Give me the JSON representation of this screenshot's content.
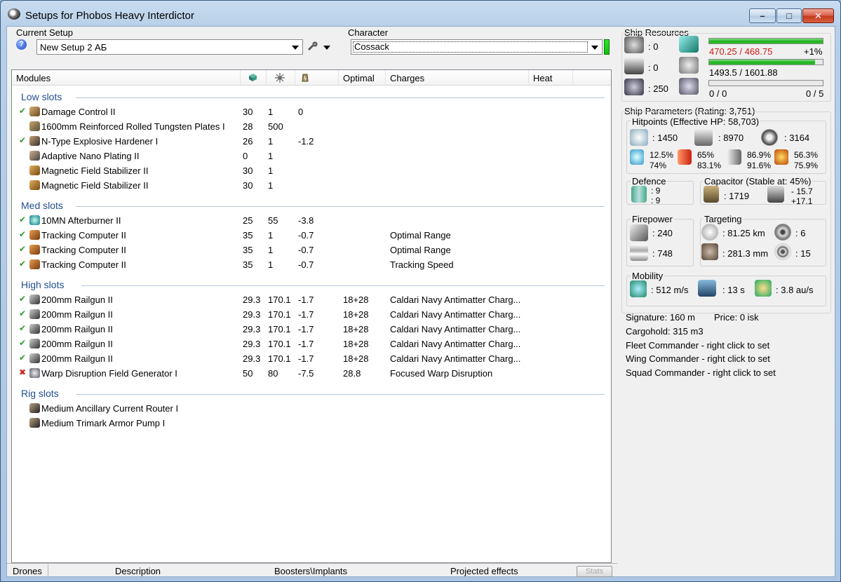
{
  "window": {
    "title": "Setups for Phobos Heavy Interdictor"
  },
  "current_setup": {
    "label": "Current Setup",
    "value": "New Setup 2 АБ"
  },
  "character": {
    "label": "Character",
    "value": "Cossack"
  },
  "modules": {
    "headers": {
      "modules": "Modules",
      "optimal": "Optimal",
      "charges": "Charges",
      "heat": "Heat"
    },
    "sections": [
      {
        "title": "Low slots",
        "rows": [
          {
            "state": "on",
            "icon": "damage-control-icon",
            "name": "Damage Control II",
            "c1": "30",
            "c2": "1",
            "c3": "0",
            "optimal": "",
            "charges": ""
          },
          {
            "state": "none",
            "icon": "armor-plate-icon",
            "name": "1600mm Reinforced Rolled Tungsten Plates I",
            "c1": "28",
            "c2": "500",
            "c3": "",
            "optimal": "",
            "charges": ""
          },
          {
            "state": "on",
            "icon": "armor-hardener-icon",
            "name": "N-Type Explosive Hardener I",
            "c1": "26",
            "c2": "1",
            "c3": "-1.2",
            "optimal": "",
            "charges": ""
          },
          {
            "state": "none",
            "icon": "nano-plating-icon",
            "name": "Adaptive Nano Plating II",
            "c1": "0",
            "c2": "1",
            "c3": "",
            "optimal": "",
            "charges": ""
          },
          {
            "state": "none",
            "icon": "mag-stab-icon",
            "name": "Magnetic Field Stabilizer II",
            "c1": "30",
            "c2": "1",
            "c3": "",
            "optimal": "",
            "charges": ""
          },
          {
            "state": "none",
            "icon": "mag-stab-icon",
            "name": "Magnetic Field Stabilizer II",
            "c1": "30",
            "c2": "1",
            "c3": "",
            "optimal": "",
            "charges": ""
          }
        ]
      },
      {
        "title": "Med slots",
        "rows": [
          {
            "state": "on",
            "icon": "afterburner-icon",
            "name": "10MN Afterburner II",
            "c1": "25",
            "c2": "55",
            "c3": "-3.8",
            "optimal": "",
            "charges": ""
          },
          {
            "state": "on",
            "icon": "tracking-computer-icon",
            "name": "Tracking Computer II",
            "c1": "35",
            "c2": "1",
            "c3": "-0.7",
            "optimal": "",
            "charges": "Optimal Range"
          },
          {
            "state": "on",
            "icon": "tracking-computer-icon",
            "name": "Tracking Computer II",
            "c1": "35",
            "c2": "1",
            "c3": "-0.7",
            "optimal": "",
            "charges": "Optimal Range"
          },
          {
            "state": "on",
            "icon": "tracking-computer-icon",
            "name": "Tracking Computer II",
            "c1": "35",
            "c2": "1",
            "c3": "-0.7",
            "optimal": "",
            "charges": "Tracking Speed"
          }
        ]
      },
      {
        "title": "High slots",
        "rows": [
          {
            "state": "on",
            "icon": "railgun-icon",
            "name": "200mm Railgun II",
            "c1": "29.3",
            "c2": "170.1",
            "c3": "-1.7",
            "optimal": "18+28",
            "charges": "Caldari Navy Antimatter Charg..."
          },
          {
            "state": "on",
            "icon": "railgun-icon",
            "name": "200mm Railgun II",
            "c1": "29.3",
            "c2": "170.1",
            "c3": "-1.7",
            "optimal": "18+28",
            "charges": "Caldari Navy Antimatter Charg..."
          },
          {
            "state": "on",
            "icon": "railgun-icon",
            "name": "200mm Railgun II",
            "c1": "29.3",
            "c2": "170.1",
            "c3": "-1.7",
            "optimal": "18+28",
            "charges": "Caldari Navy Antimatter Charg..."
          },
          {
            "state": "on",
            "icon": "railgun-icon",
            "name": "200mm Railgun II",
            "c1": "29.3",
            "c2": "170.1",
            "c3": "-1.7",
            "optimal": "18+28",
            "charges": "Caldari Navy Antimatter Charg..."
          },
          {
            "state": "on",
            "icon": "railgun-icon",
            "name": "200mm Railgun II",
            "c1": "29.3",
            "c2": "170.1",
            "c3": "-1.7",
            "optimal": "18+28",
            "charges": "Caldari Navy Antimatter Charg..."
          },
          {
            "state": "off",
            "icon": "warp-disruption-icon",
            "name": "Warp Disruption Field Generator I",
            "c1": "50",
            "c2": "80",
            "c3": "-7.5",
            "optimal": "28.8",
            "charges": "Focused Warp Disruption"
          }
        ]
      },
      {
        "title": "Rig slots",
        "rows": [
          {
            "state": "none",
            "icon": "rig-icon",
            "name": "Medium Ancillary Current Router I",
            "c1": "",
            "c2": "",
            "c3": "",
            "optimal": "",
            "charges": ""
          },
          {
            "state": "none",
            "icon": "rig-icon",
            "name": "Medium Trimark Armor Pump I",
            "c1": "",
            "c2": "",
            "c3": "",
            "optimal": "",
            "charges": ""
          }
        ]
      }
    ]
  },
  "bottom_tabs": {
    "drones": "Drones",
    "description": "Description",
    "boosters": "Boosters\\Implants",
    "projected": "Projected effects",
    "stats": "Stats"
  },
  "ship_resources": {
    "title": "Ship Resources",
    "turret_hardpoints": ": 0",
    "launcher_hardpoints": ": 0",
    "drone_bay": ": 250",
    "cpu": {
      "text": "470.25 / 468.75",
      "extra": "+1%",
      "fraction": 1.0
    },
    "powergrid": {
      "text": "1493.5 / 1601.88",
      "fraction": 0.93
    },
    "calibration": {
      "left": "0 / 0",
      "right": "0 / 5",
      "fraction": 0.0
    },
    "colors": {
      "overload": "#d01818"
    }
  },
  "ship_parameters": {
    "title": "Ship Parameters (Rating: 3,751)",
    "hitpoints_title": "Hitpoints (Effective HP: 58,703)",
    "shield_hp": ": 1450",
    "armor_hp": ": 8970",
    "structure_hp": ": 3164",
    "resists": [
      {
        "icon": "em-resist-icon",
        "shield": "12.5%",
        "armor": "74%"
      },
      {
        "icon": "thermal-resist-icon",
        "shield": "65%",
        "armor": "83.1%"
      },
      {
        "icon": "kinetic-resist-icon",
        "shield": "86.9%",
        "armor": "91.6%"
      },
      {
        "icon": "explosive-resist-icon",
        "shield": "56.3%",
        "armor": "75.9%"
      }
    ],
    "defence": {
      "title": "Defence",
      "v1": ": 9",
      "v2": ": 9"
    },
    "capacitor": {
      "title": "Capacitor (Stable at: 45%)",
      "capacity": ": 1719",
      "delta1": "- 15.7",
      "delta2": "+17.1"
    },
    "firepower": {
      "title": "Firepower",
      "dps": ": 240",
      "volley": ": 748"
    },
    "targeting": {
      "title": "Targeting",
      "range": ": 81.25 km",
      "max_targets": ": 6",
      "scan_res": ": 281.3 mm",
      "sensor": ": 15"
    },
    "mobility": {
      "title": "Mobility",
      "speed": ": 512 m/s",
      "align": ": 13 s",
      "warp": ": 3.8 au/s"
    }
  },
  "ship_info": {
    "signature": "Signature: 160 m",
    "price": "Price: 0 isk",
    "cargohold": "Cargohold: 315 m3",
    "fleet_commander": "Fleet Commander - right click to set",
    "wing_commander": "Wing Commander - right click to set",
    "squad_commander": "Squad Commander - right click to set"
  }
}
